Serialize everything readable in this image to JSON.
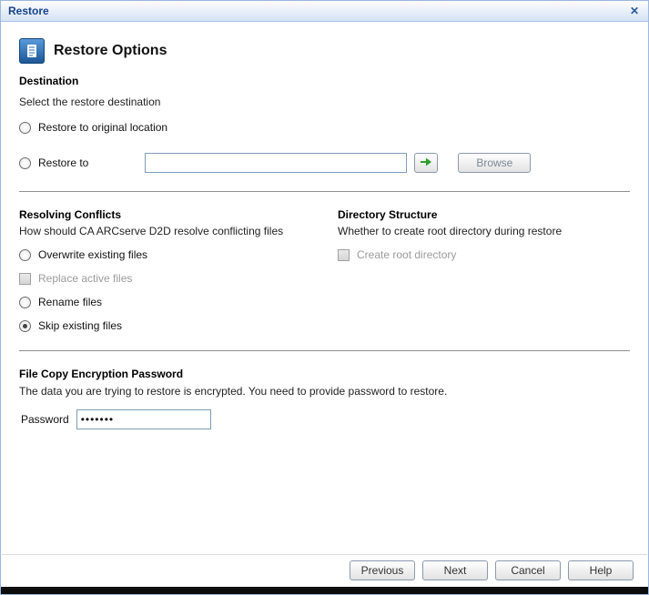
{
  "window": {
    "title": "Restore",
    "close_icon": "✕"
  },
  "colors": {
    "title_blue": "#15428b",
    "arrow_green": "#2e9e2e"
  },
  "header": {
    "title": "Restore Options"
  },
  "destination": {
    "heading": "Destination",
    "subtitle": "Select the restore destination",
    "options": [
      {
        "label": "Restore to original location",
        "checked": false
      },
      {
        "label": "Restore to",
        "checked": false
      }
    ],
    "restore_to_value": "",
    "browse_label": "Browse"
  },
  "resolving_conflicts": {
    "heading": "Resolving Conflicts",
    "subtitle": "How should CA ARCserve D2D  resolve conflicting files",
    "options": [
      {
        "label": "Overwrite existing files",
        "type": "radio",
        "checked": false,
        "disabled": false
      },
      {
        "label": "Replace active files",
        "type": "checkbox",
        "checked": false,
        "disabled": true
      },
      {
        "label": "Rename files",
        "type": "radio",
        "checked": false,
        "disabled": false
      },
      {
        "label": "Skip existing files",
        "type": "radio",
        "checked": true,
        "disabled": false
      }
    ]
  },
  "directory_structure": {
    "heading": "Directory Structure",
    "subtitle": "Whether to create root directory during restore",
    "checkbox": {
      "label": "Create root directory",
      "checked": false,
      "disabled": true
    }
  },
  "encryption": {
    "heading": "File Copy Encryption Password",
    "subtitle": "The data you are trying to restore is encrypted. You need to provide password to restore.",
    "password_label": "Password",
    "password_value": "•••••••"
  },
  "footer": {
    "buttons": [
      "Previous",
      "Next",
      "Cancel",
      "Help"
    ]
  }
}
